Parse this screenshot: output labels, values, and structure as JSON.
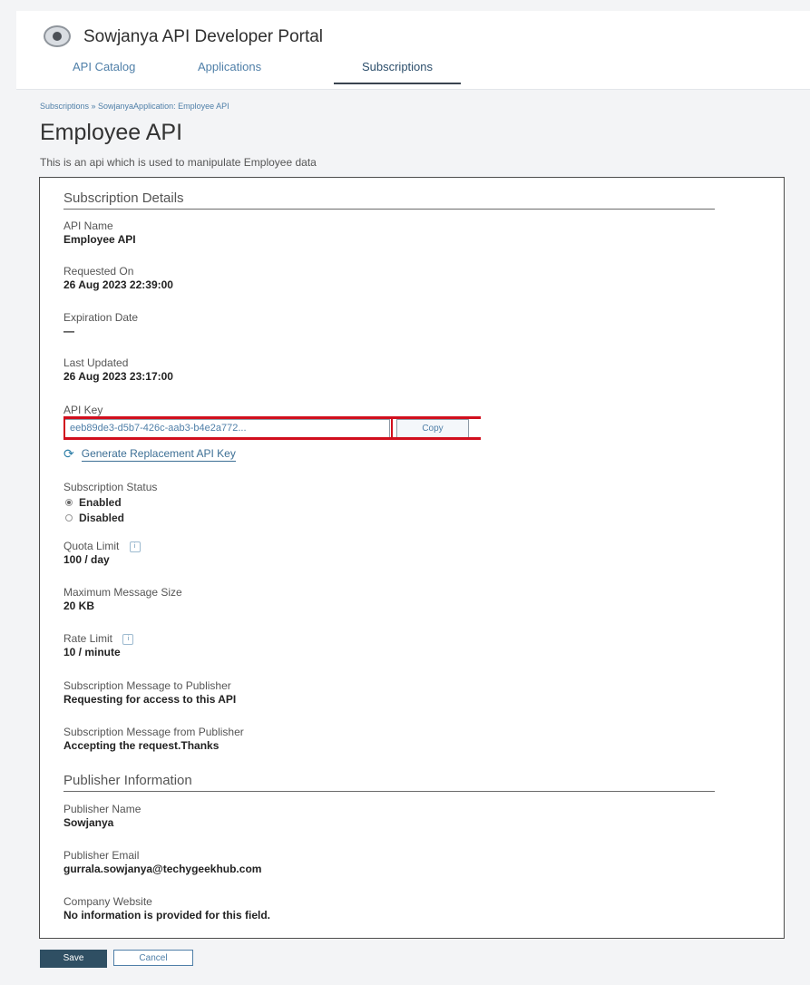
{
  "header": {
    "title": "Sowjanya API Developer Portal",
    "tabs": [
      {
        "label": "API Catalog",
        "active": false
      },
      {
        "label": "Applications",
        "active": false
      },
      {
        "label": "Subscriptions",
        "active": true
      }
    ]
  },
  "breadcrumb": "Subscriptions » SowjanyaApplication: Employee API",
  "page": {
    "title": "Employee API",
    "description": "This is an api which is used to manipulate Employee data"
  },
  "subscription": {
    "section_title": "Subscription Details",
    "api_name_label": "API Name",
    "api_name": "Employee API",
    "requested_on_label": "Requested On",
    "requested_on": "26 Aug 2023 22:39:00",
    "expiration_label": "Expiration Date",
    "expiration": "—",
    "last_updated_label": "Last Updated",
    "last_updated": "26 Aug 2023 23:17:00",
    "api_key_label": "API Key",
    "api_key": "eeb89de3-d5b7-426c-aab3-b4e2a772...",
    "copy_label": "Copy",
    "regenerate_label": "Generate Replacement API Key",
    "status_label": "Subscription Status",
    "status_options": [
      {
        "label": "Enabled",
        "checked": true
      },
      {
        "label": "Disabled",
        "checked": false
      }
    ],
    "quota_label": "Quota Limit",
    "quota": "100 / day",
    "max_message_label": "Maximum Message Size",
    "max_message": "20 KB",
    "rate_label": "Rate Limit",
    "rate": "10 / minute",
    "msg_to_label": "Subscription Message to Publisher",
    "msg_to": "Requesting for access to this API",
    "msg_from_label": "Subscription Message from Publisher",
    "msg_from": "Accepting the request.Thanks"
  },
  "publisher": {
    "section_title": "Publisher Information",
    "name_label": "Publisher Name",
    "name": "Sowjanya",
    "email_label": "Publisher Email",
    "email": "gurrala.sowjanya@techygeekhub.com",
    "website_label": "Company Website",
    "website": "No information is provided for this field."
  },
  "footer": {
    "save_label": "Save",
    "cancel_label": "Cancel"
  },
  "colors": {
    "highlight": "#d10f1d",
    "link": "#4f7fa8",
    "save_button": "#2f4f63"
  }
}
